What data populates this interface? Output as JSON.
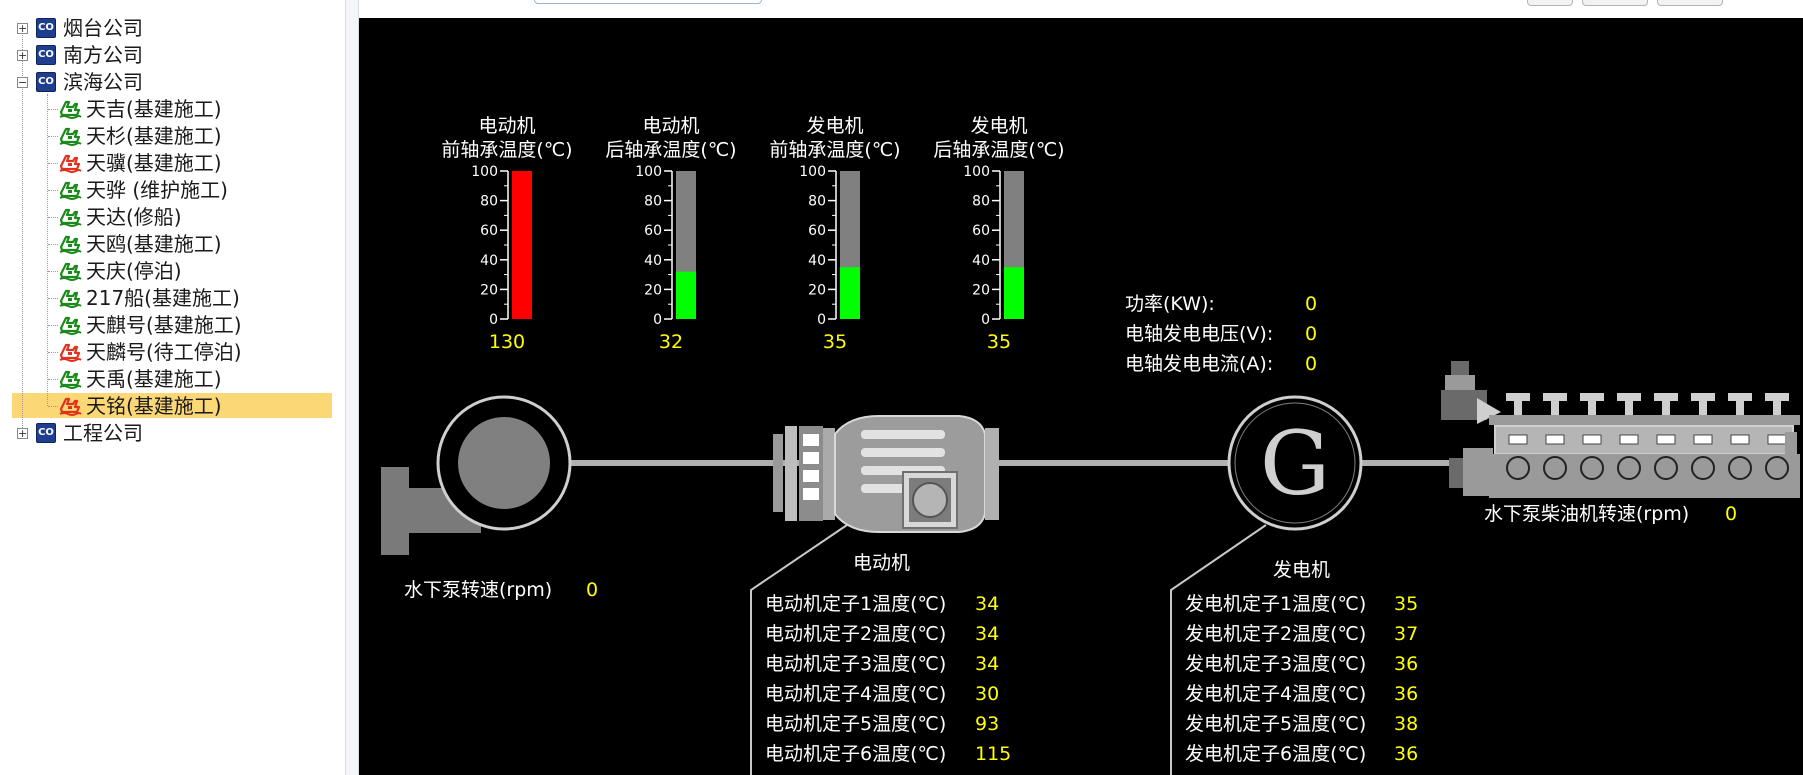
{
  "tree": {
    "companies": [
      {
        "label": "烟台公司",
        "expanded": false,
        "icon": "company-icon"
      },
      {
        "label": "南方公司",
        "expanded": false,
        "icon": "company-icon"
      },
      {
        "label": "滨海公司",
        "expanded": true,
        "icon": "company-icon",
        "ships": [
          {
            "label": "天吉(基建施工)",
            "status_color": "#1a8a1a"
          },
          {
            "label": "天杉(基建施工)",
            "status_color": "#1a8a1a"
          },
          {
            "label": "天骥(基建施工)",
            "status_color": "#e0321e"
          },
          {
            "label": "天骅 (维护施工)",
            "status_color": "#1a8a1a"
          },
          {
            "label": "天达(修船)",
            "status_color": "#1a8a1a"
          },
          {
            "label": "天鸥(基建施工)",
            "status_color": "#1a8a1a"
          },
          {
            "label": "天庆(停泊)",
            "status_color": "#1a8a1a"
          },
          {
            "label": "217船(基建施工)",
            "status_color": "#1a8a1a"
          },
          {
            "label": "天麒号(基建施工)",
            "status_color": "#1a8a1a"
          },
          {
            "label": "天麟号(待工停泊)",
            "status_color": "#e0321e"
          },
          {
            "label": "天禹(基建施工)",
            "status_color": "#1a8a1a"
          },
          {
            "label": "天铭(基建施工)",
            "status_color": "#e0321e",
            "selected": true
          }
        ]
      },
      {
        "label": "工程公司",
        "expanded": false,
        "icon": "company-icon"
      }
    ]
  },
  "gauges": [
    {
      "title1": "电动机",
      "title2": "前轴承温度(℃)",
      "value": 130,
      "fill_color": "#ff0000"
    },
    {
      "title1": "电动机",
      "title2": "后轴承温度(℃)",
      "value": 32,
      "fill_color": "#00ff00"
    },
    {
      "title1": "发电机",
      "title2": "前轴承温度(℃)",
      "value": 35,
      "fill_color": "#00ff00"
    },
    {
      "title1": "发电机",
      "title2": "后轴承温度(℃)",
      "value": 35,
      "fill_color": "#00ff00"
    }
  ],
  "gauge_ticks": [
    "100",
    "80",
    "60",
    "40",
    "20",
    "0"
  ],
  "gauge_max": 100,
  "power": {
    "rows": [
      {
        "label": "功率(KW):",
        "value": "0"
      },
      {
        "label": "电轴发电电压(V):",
        "value": "0"
      },
      {
        "label": "电轴发电电流(A):",
        "value": "0"
      }
    ]
  },
  "pump": {
    "label": "水下泵转速(rpm)",
    "value": "0"
  },
  "motor": {
    "label": "电动机"
  },
  "generator": {
    "label": "发电机",
    "symbol": "G"
  },
  "diesel": {
    "label": "水下泵柴油机转速(rpm)",
    "value": "0"
  },
  "motor_stators": [
    {
      "label": "电动机定子1温度(℃)",
      "value": "34"
    },
    {
      "label": "电动机定子2温度(℃)",
      "value": "34"
    },
    {
      "label": "电动机定子3温度(℃)",
      "value": "34"
    },
    {
      "label": "电动机定子4温度(℃)",
      "value": "30"
    },
    {
      "label": "电动机定子5温度(℃)",
      "value": "93"
    },
    {
      "label": "电动机定子6温度(℃)",
      "value": "115"
    }
  ],
  "gen_stators": [
    {
      "label": "发电机定子1温度(℃)",
      "value": "35"
    },
    {
      "label": "发电机定子2温度(℃)",
      "value": "37"
    },
    {
      "label": "发电机定子3温度(℃)",
      "value": "36"
    },
    {
      "label": "发电机定子4温度(℃)",
      "value": "36"
    },
    {
      "label": "发电机定子5温度(℃)",
      "value": "38"
    },
    {
      "label": "发电机定子6温度(℃)",
      "value": "36"
    }
  ],
  "colors": {
    "panel_bg": "#000000",
    "label_text": "#ffffff",
    "value_text": "#ffff00",
    "shaft": "#b0b0b0",
    "selection": "#fbd775"
  }
}
